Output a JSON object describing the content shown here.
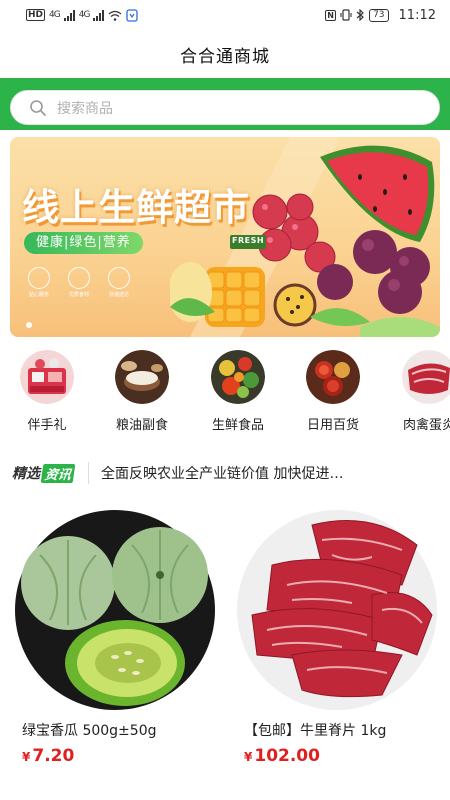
{
  "status_bar": {
    "battery": "73",
    "time": "11:12",
    "network_hd": "HD",
    "signal_1": "4G",
    "signal_2": "4G"
  },
  "header": {
    "title": "合合通商城"
  },
  "search": {
    "placeholder": "搜索商品"
  },
  "banner": {
    "title": "线上生鲜超市",
    "tagline": "健康|绿色|营养",
    "features": [
      "贴心服务",
      "优质食材",
      "快速送达"
    ],
    "badge": "FRESH"
  },
  "categories": [
    {
      "label": "伴手礼",
      "icon": "gift-basket-image"
    },
    {
      "label": "粮油副食",
      "icon": "grain-bowl-image"
    },
    {
      "label": "生鲜食品",
      "icon": "vegetables-image"
    },
    {
      "label": "日用百货",
      "icon": "spice-bowls-image"
    },
    {
      "label": "肉禽蛋炎",
      "icon": "meat-image"
    }
  ],
  "news": {
    "logo_a": "精选",
    "logo_b": "资讯",
    "headline": "全面反映农业全产业链价值 加快促进…"
  },
  "products": [
    {
      "name": "绿宝香瓜 500g±50g",
      "currency": "¥",
      "price": "7.20"
    },
    {
      "name": "【包邮】牛里脊片 1kg",
      "currency": "¥",
      "price": "102.00"
    }
  ],
  "colors": {
    "brand_green": "#2cb44a",
    "price_red": "#e02020"
  }
}
